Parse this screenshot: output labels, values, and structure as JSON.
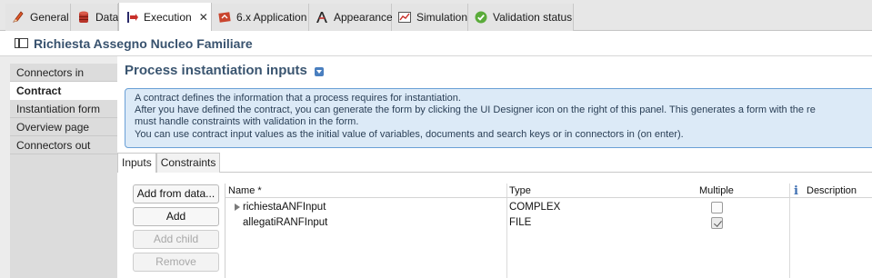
{
  "tabs": [
    {
      "label": "General",
      "icon": "pencil-icon"
    },
    {
      "label": "Data",
      "icon": "database-icon"
    },
    {
      "label": "Execution",
      "icon": "execution-icon",
      "active": true
    },
    {
      "label": "6.x Application",
      "icon": "application-icon"
    },
    {
      "label": "Appearance",
      "icon": "appearance-icon"
    },
    {
      "label": "Simulation",
      "icon": "simulation-chart-icon"
    },
    {
      "label": "Validation status",
      "icon": "check-circle-icon"
    }
  ],
  "title": "Richiesta Assegno Nucleo Familiare",
  "left_nav": [
    "Connectors in",
    "Contract",
    "Instantiation form",
    "Overview page",
    "Connectors out"
  ],
  "left_nav_active": "Contract",
  "section_title": "Process instantiation inputs",
  "info_lines": [
    "A contract defines the information that a process requires for instantiation.",
    "After you have defined the contract, you can generate the form by clicking the UI Designer icon on the right of this panel. This generates a form with the re",
    "must handle constraints with validation in the form.",
    "You can use contract input values as the initial value of variables, documents and search keys or in connectors in (on enter)."
  ],
  "inner_tabs": [
    "Inputs",
    "Constraints"
  ],
  "buttons": {
    "add_from_data": "Add from data...",
    "add": "Add",
    "add_child": "Add child",
    "remove": "Remove"
  },
  "table": {
    "headers": {
      "name": "Name *",
      "type": "Type",
      "multiple": "Multiple",
      "description": "Description"
    },
    "rows": [
      {
        "name": "richiestaANFInput",
        "type": "COMPLEX",
        "multiple": false,
        "expandable": true
      },
      {
        "name": "allegatiRANFInput",
        "type": "FILE",
        "multiple": true,
        "expandable": false
      }
    ]
  },
  "colors": {
    "accent_title": "#38526e",
    "info_bg": "#dceaf7",
    "info_border": "#6aa0d6"
  }
}
